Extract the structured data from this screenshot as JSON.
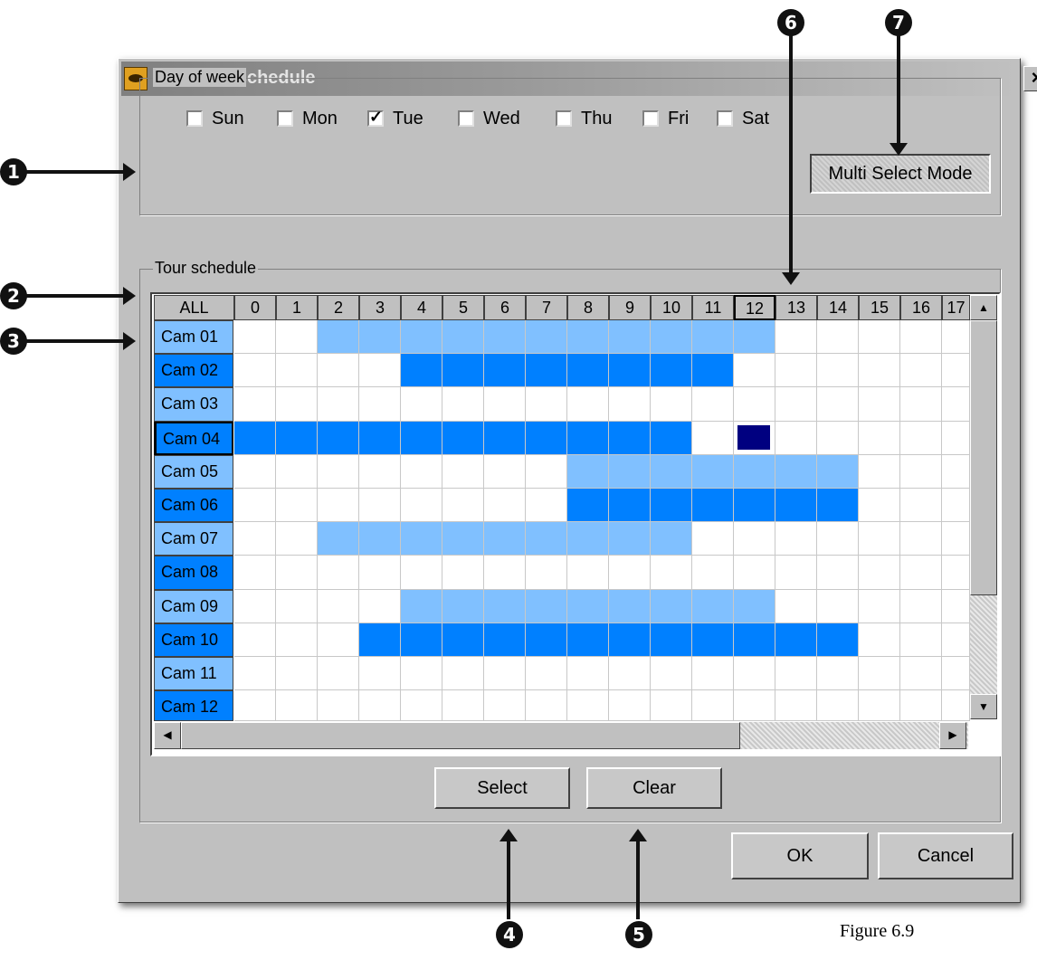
{
  "window": {
    "title": "PTZ Tour schedule",
    "close_glyph": "×"
  },
  "day_group": {
    "legend": "Day of week"
  },
  "days": [
    {
      "label": "Sun",
      "checked": false
    },
    {
      "label": "Mon",
      "checked": false
    },
    {
      "label": "Tue",
      "checked": true
    },
    {
      "label": "Wed",
      "checked": false
    },
    {
      "label": "Thu",
      "checked": false
    },
    {
      "label": "Fri",
      "checked": false
    },
    {
      "label": "Sat",
      "checked": false
    }
  ],
  "multi_select_label": "Multi Select Mode",
  "schedule_group": {
    "legend": "Tour schedule"
  },
  "grid": {
    "all_label": "ALL",
    "hours": [
      "0",
      "1",
      "2",
      "3",
      "4",
      "5",
      "6",
      "7",
      "8",
      "9",
      "10",
      "11",
      "12",
      "13",
      "14",
      "15",
      "16",
      "17"
    ],
    "selected_hour": "12",
    "cameras": [
      "Cam 01",
      "Cam 02",
      "Cam 03",
      "Cam 04",
      "Cam 05",
      "Cam 06",
      "Cam 07",
      "Cam 08",
      "Cam 09",
      "Cam 10",
      "Cam 11",
      "Cam 12"
    ],
    "selected_camera": "Cam 04",
    "schedule": [
      {
        "camera": "Cam 01",
        "hours": [
          2,
          3,
          4,
          5,
          6,
          7,
          8,
          9,
          10,
          11,
          12
        ],
        "shade": "light"
      },
      {
        "camera": "Cam 02",
        "hours": [
          4,
          5,
          6,
          7,
          8,
          9,
          10,
          11
        ],
        "shade": "dark"
      },
      {
        "camera": "Cam 03",
        "hours": [],
        "shade": "light"
      },
      {
        "camera": "Cam 04",
        "hours": [
          0,
          1,
          2,
          3,
          4,
          5,
          6,
          7,
          8,
          9,
          10
        ],
        "shade": "dark",
        "focus_hour": 12
      },
      {
        "camera": "Cam 05",
        "hours": [
          8,
          9,
          10,
          11,
          12,
          13,
          14
        ],
        "shade": "light"
      },
      {
        "camera": "Cam 06",
        "hours": [
          8,
          9,
          10,
          11,
          12,
          13,
          14
        ],
        "shade": "dark"
      },
      {
        "camera": "Cam 07",
        "hours": [
          2,
          3,
          4,
          5,
          6,
          7,
          8,
          9,
          10
        ],
        "shade": "light"
      },
      {
        "camera": "Cam 08",
        "hours": [],
        "shade": "dark"
      },
      {
        "camera": "Cam 09",
        "hours": [
          4,
          5,
          6,
          7,
          8,
          9,
          10,
          11,
          12
        ],
        "shade": "light"
      },
      {
        "camera": "Cam 10",
        "hours": [
          3,
          4,
          5,
          6,
          7,
          8,
          9,
          10,
          11,
          12,
          13,
          14
        ],
        "shade": "dark"
      },
      {
        "camera": "Cam 11",
        "hours": [],
        "shade": "light"
      },
      {
        "camera": "Cam 12",
        "hours": [],
        "shade": "dark"
      }
    ]
  },
  "scroll_glyphs": {
    "up": "▲",
    "down": "▼",
    "left": "◀",
    "right": "▶"
  },
  "buttons": {
    "select": "Select",
    "clear": "Clear",
    "ok": "OK",
    "cancel": "Cancel"
  },
  "callouts": [
    "1",
    "2",
    "3",
    "4",
    "5",
    "6",
    "7"
  ],
  "caption": "Figure 6.9",
  "colors": {
    "light": "#80c0ff",
    "dark": "#0080ff",
    "focus": "#000080",
    "row_light": "#80c0ff",
    "row_dark": "#0080ff"
  }
}
